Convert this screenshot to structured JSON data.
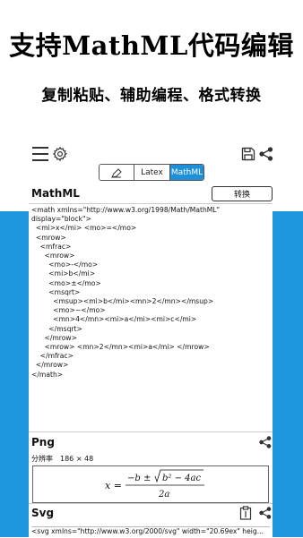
{
  "promo": {
    "headline": "支持MathML代码编辑",
    "subline": "复制粘贴、辅助编程、格式转换"
  },
  "toolbar": {
    "menu_icon": "menu-icon",
    "settings_icon": "gear-icon",
    "save_icon": "save-icon",
    "share_icon": "share-icon"
  },
  "mode_switch": {
    "pen_icon": "pen-icon",
    "latex_label": "Latex",
    "mathml_label": "MathML",
    "selected": "MathML"
  },
  "mathml_section": {
    "title": "MathML",
    "convert_label": "转换",
    "code_lines": [
      "<math xmlns=\"http://www.w3.org/1998/Math/MathML\"",
      "display=\"block\">",
      "  <mi>x</mi> <mo>=</mo>",
      "  <mrow>",
      "    <mfrac>",
      "      <mrow>",
      "        <mo>-</mo>",
      "        <mi>b</mi>",
      "        <mo>±</mo>",
      "        <msqrt>",
      "          <msup><mi>b</mi><mn>2</mn></msup>",
      "          <mo>−</mo>",
      "          <mn>4</mn><mi>a</mi><mi>c</mi>",
      "        </msqrt>",
      "      </mrow>",
      "      <mrow> <mn>2</mn><mi>a</mi> </mrow>",
      "    </mfrac>",
      "  </mrow>",
      "</math>"
    ]
  },
  "png_section": {
    "title": "Png",
    "resolution_label": "分辨率",
    "resolution_value": "186 × 48",
    "formula": {
      "lhs": "x =",
      "numerator": "−b ± ",
      "radicand": "b² − 4ac",
      "denominator": "2a"
    }
  },
  "svg_section": {
    "title": "Svg",
    "code_preview": "<svg xmlns=\"http://www.w3.org/2000/svg\" width=\"20.69ex\" heig..."
  },
  "colors": {
    "accent": "#1e96de",
    "segment_selected": "#1e8fd9"
  }
}
